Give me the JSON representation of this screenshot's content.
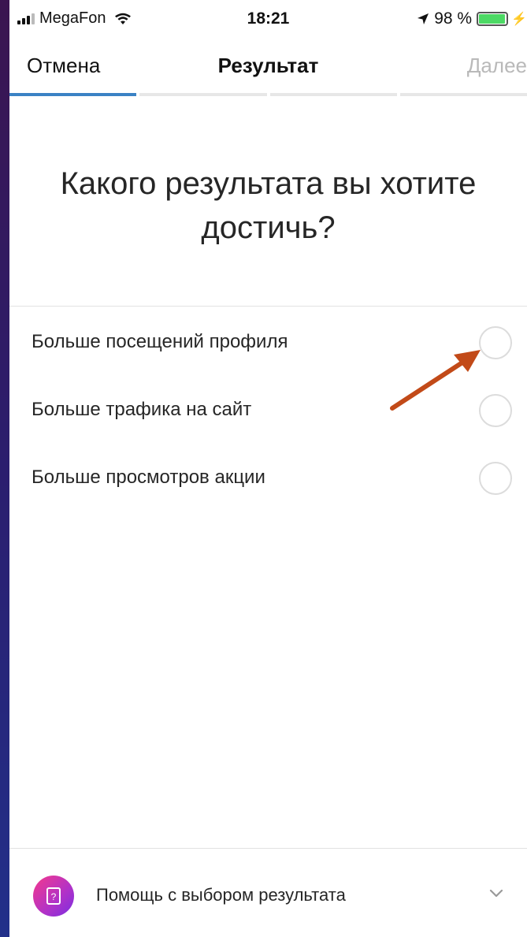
{
  "status_bar": {
    "carrier": "MegaFon",
    "time": "18:21",
    "battery": "98 %",
    "battery_level": 0.98
  },
  "nav": {
    "cancel": "Отмена",
    "title": "Результат",
    "next": "Далее"
  },
  "progress_steps": 4,
  "progress_active": 1,
  "question": {
    "line1": "Какого результата вы хотите",
    "line2": "достичь?"
  },
  "options": [
    {
      "label": "Больше посещений профиля"
    },
    {
      "label": "Больше трафика на сайт"
    },
    {
      "label": "Больше просмотров акции"
    }
  ],
  "help": {
    "label": "Помощь с выбором результата",
    "icon": "help-book-icon"
  },
  "colors": {
    "accent": "#3b82c4",
    "arrow": "#c24a18",
    "disabled": "#b9b9b9"
  }
}
